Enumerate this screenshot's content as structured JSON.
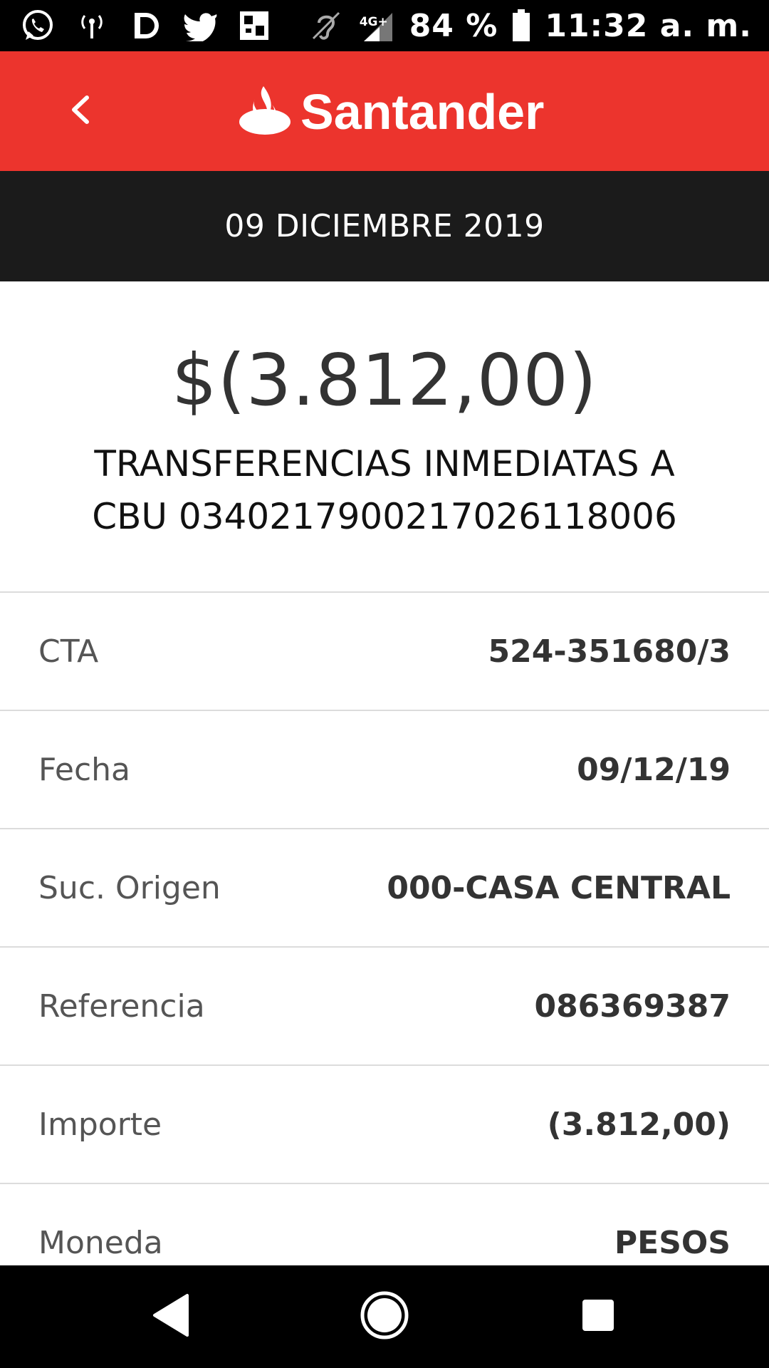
{
  "status_bar": {
    "network_label": "4G+",
    "battery": "84 %",
    "time": "11:32 a. m.",
    "icons": [
      "whatsapp-icon",
      "hotspot-icon",
      "d-app-icon",
      "twitter-icon",
      "photo-app-icon",
      "hearing-aid-icon",
      "signal-icon",
      "battery-icon"
    ]
  },
  "header": {
    "brand_name": "Santander",
    "brand_color": "#ec342d",
    "back_icon": "chevron-left-icon"
  },
  "date_band": {
    "date": "09 DICIEMBRE 2019"
  },
  "summary": {
    "amount": "$(3.812,00)",
    "description": "TRANSFERENCIAS INMEDIATAS A CBU 0340217900217026118006"
  },
  "details": [
    {
      "label": "CTA",
      "value": "524-351680/3"
    },
    {
      "label": "Fecha",
      "value": "09/12/19"
    },
    {
      "label": "Suc. Origen",
      "value": "000-CASA CENTRAL"
    },
    {
      "label": "Referencia",
      "value": "086369387"
    },
    {
      "label": "Importe",
      "value": "(3.812,00)"
    },
    {
      "label": "Moneda",
      "value": "PESOS"
    }
  ],
  "nav_bar": {
    "icons": [
      "back-triangle-icon",
      "home-circle-icon",
      "recents-square-icon"
    ]
  }
}
